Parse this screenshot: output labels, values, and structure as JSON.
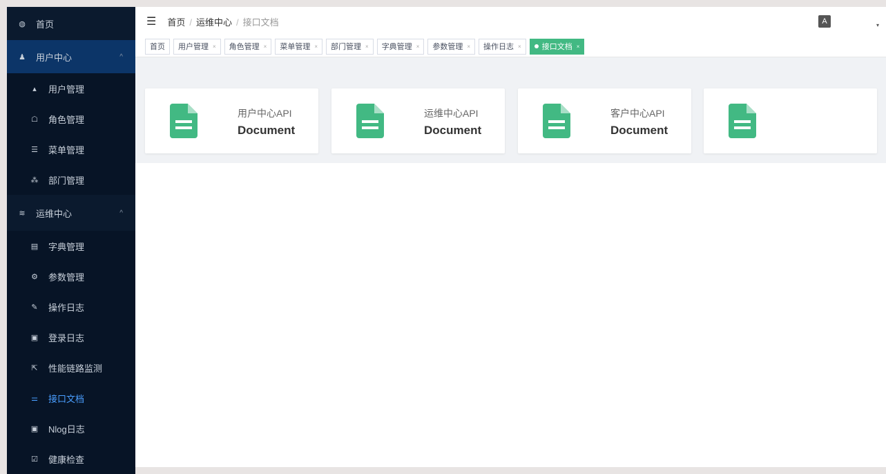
{
  "sidebar": {
    "items": [
      {
        "label": "首页",
        "icon": "dashboard-icon",
        "glyph": "◍"
      },
      {
        "label": "用户中心",
        "icon": "users-icon",
        "glyph": "♟",
        "arrow": "^"
      },
      {
        "label": "用户管理",
        "icon": "user-icon",
        "glyph": "▴"
      },
      {
        "label": "角色管理",
        "icon": "role-icon",
        "glyph": "☖"
      },
      {
        "label": "菜单管理",
        "icon": "list-icon",
        "glyph": "☰"
      },
      {
        "label": "部门管理",
        "icon": "tree-icon",
        "glyph": "⁂"
      },
      {
        "label": "运维中心",
        "icon": "server-icon",
        "glyph": "≋",
        "arrow": "^"
      },
      {
        "label": "字典管理",
        "icon": "dict-icon",
        "glyph": "▤"
      },
      {
        "label": "参数管理",
        "icon": "gears-icon",
        "glyph": "⚙"
      },
      {
        "label": "操作日志",
        "icon": "edit-icon",
        "glyph": "✎"
      },
      {
        "label": "登录日志",
        "icon": "log-icon",
        "glyph": "▣"
      },
      {
        "label": "性能链路监测",
        "icon": "external-link-icon",
        "glyph": "⇱"
      },
      {
        "label": "接口文档",
        "icon": "sliders-icon",
        "glyph": "⚌"
      },
      {
        "label": "Nlog日志",
        "icon": "log-icon",
        "glyph": "▣"
      },
      {
        "label": "健康检查",
        "icon": "monitor-icon",
        "glyph": "☑"
      }
    ]
  },
  "header": {
    "menu_glyph": "☰",
    "breadcrumb": [
      "首页",
      "运维中心",
      "接口文档"
    ],
    "sep": "/",
    "lang": "A",
    "caret": "▾"
  },
  "tags": [
    {
      "label": "首页"
    },
    {
      "label": "用户管理",
      "close": "×"
    },
    {
      "label": "角色管理",
      "close": "×"
    },
    {
      "label": "菜单管理",
      "close": "×"
    },
    {
      "label": "部门管理",
      "close": "×"
    },
    {
      "label": "字典管理",
      "close": "×"
    },
    {
      "label": "参数管理",
      "close": "×"
    },
    {
      "label": "操作日志",
      "close": "×"
    },
    {
      "label": "接口文档",
      "close": "×"
    }
  ],
  "cards": [
    {
      "title": "用户中心API",
      "subtitle": "Document"
    },
    {
      "title": "运维中心API",
      "subtitle": "Document"
    },
    {
      "title": "客户中心API",
      "subtitle": "Document"
    },
    {
      "title": "",
      "subtitle": ""
    }
  ],
  "colors": {
    "accent": "#42b983",
    "sidebar": "#0b1a2e",
    "active_text": "#4a9eff"
  }
}
